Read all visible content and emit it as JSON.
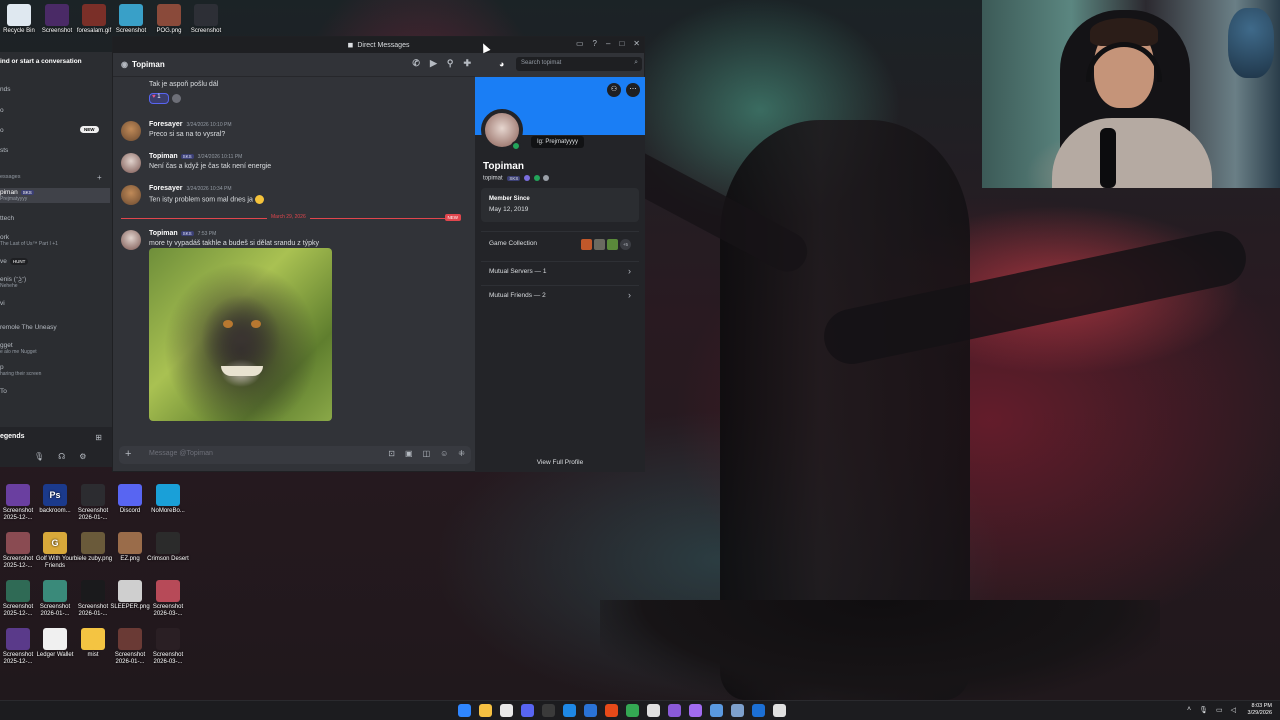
{
  "desktop": {
    "top_icons": [
      {
        "label": "Recycle Bin",
        "icon": "recycle-bin-icon",
        "color": "#dfe8f0"
      },
      {
        "label": "Screenshot",
        "icon": "screenshot-thumb",
        "color": "#4a2a66"
      },
      {
        "label": "foresalam.gif",
        "icon": "gif-thumb",
        "color": "#7a2f28"
      },
      {
        "label": "Screenshot",
        "icon": "screenshot-thumb",
        "color": "#39a0c8"
      },
      {
        "label": "POG.png",
        "icon": "image-thumb",
        "color": "#8a4a3a"
      },
      {
        "label": "Screenshot",
        "icon": "screenshot-thumb",
        "color": "#2d2f36"
      }
    ],
    "grid_icons": [
      {
        "label": "Screenshot 2025-12-...",
        "color": "#6a3fa0",
        "glyph": ""
      },
      {
        "label": "backroom...",
        "color": "#1b3a8c",
        "glyph": "Ps"
      },
      {
        "label": "Screenshot 2026-01-...",
        "color": "#2c2c30",
        "glyph": ""
      },
      {
        "label": "Discord",
        "color": "#5865f2",
        "glyph": ""
      },
      {
        "label": "NoMoreBo...",
        "color": "#1aa0d8",
        "glyph": ""
      },
      {
        "label": "Screenshot 2025-12-...",
        "color": "#8a4b52",
        "glyph": ""
      },
      {
        "label": "Golf With Your Friends",
        "color": "#d8a83a",
        "glyph": "G"
      },
      {
        "label": "biele zuby.png",
        "color": "#6a5a3a",
        "glyph": ""
      },
      {
        "label": "EZ.png",
        "color": "#9a6c4a",
        "glyph": ""
      },
      {
        "label": "Crimson Desert",
        "color": "#2b2b2b",
        "glyph": ""
      },
      {
        "label": "Screenshot 2025-12-...",
        "color": "#2f6a55",
        "glyph": ""
      },
      {
        "label": "Screenshot 2026-01-...",
        "color": "#3a8a7a",
        "glyph": ""
      },
      {
        "label": "Screenshot 2026-01-...",
        "color": "#1a1a1c",
        "glyph": ""
      },
      {
        "label": "SLEEPER.png",
        "color": "#cfcfcf",
        "glyph": ""
      },
      {
        "label": "Screenshot 2026-03-...",
        "color": "#b74a58",
        "glyph": ""
      },
      {
        "label": "Screenshot 2025-12-...",
        "color": "#5a3a8a",
        "glyph": ""
      },
      {
        "label": "Ledger Wallet",
        "color": "#f0f0f0",
        "glyph": ""
      },
      {
        "label": "mist",
        "color": "#f4c442",
        "glyph": ""
      },
      {
        "label": "Screenshot 2026-01-...",
        "color": "#6a3a35",
        "glyph": ""
      },
      {
        "label": "Screenshot 2026-03-...",
        "color": "#2a1f24",
        "glyph": ""
      }
    ]
  },
  "sidebar": {
    "search_label": "ind or start a conversation",
    "items": [
      {
        "label": "nds"
      },
      {
        "label": "o"
      },
      {
        "label": "o"
      },
      {
        "label": "sts"
      },
      {
        "label": "essages"
      }
    ],
    "new_badge": "NEW",
    "dm_list": [
      {
        "name": "piman",
        "sub": "Prejmatyyyy",
        "tag": "SKS",
        "active": true
      },
      {
        "name": "ttech",
        "sub": ""
      },
      {
        "name": "ork",
        "sub": "The Last of Us™ Part I +1"
      },
      {
        "name": "ve",
        "sub": "",
        "badge": "HUNT"
      },
      {
        "name": "enis (ᵔ͜ʖᵔ)",
        "sub": "Nehehe"
      },
      {
        "name": "vi",
        "sub": ""
      },
      {
        "name": "remole The Uneasy",
        "sub": ""
      },
      {
        "name": "gget",
        "sub": "e alo me Nugget"
      },
      {
        "name": "p",
        "sub": "haring their screen"
      },
      {
        "name": "To",
        "sub": ""
      }
    ],
    "bottom_name": "egends"
  },
  "window": {
    "title": "Direct Messages",
    "dm_name": "Topiman",
    "search_placeholder": "Search topimat",
    "composer_placeholder": "Message @Topiman"
  },
  "messages": [
    {
      "author": "",
      "time": "",
      "text": "Tak je aspoň pošlu dál",
      "reaction_count": "1",
      "continuation": true
    },
    {
      "author": "Foresayer",
      "time": "3/24/2026 10:10 PM",
      "text": "Preco si sa na to vysral?",
      "tag": ""
    },
    {
      "author": "Topiman",
      "time": "3/24/2026 10:11 PM",
      "text": "Není čas a když je čas tak není energie",
      "tag": "SKS"
    },
    {
      "author": "Foresayer",
      "time": "3/24/2026 10:34 PM",
      "text": "Ten isty problem som mal dnes ja",
      "tag": ""
    },
    {
      "author": "Topiman",
      "time": "7:53 PM",
      "text": "more ty vypadáš takhle a budeš si dělat srandu z týpky",
      "tag": "SKS"
    }
  ],
  "divider": {
    "date": "March 29, 2026",
    "new_label": "NEW"
  },
  "profile": {
    "tooltip": "Ig: Prejmatyyyy",
    "display_name": "Topiman",
    "username": "topimat",
    "tag": "SKS",
    "member_since_label": "Member Since",
    "member_since": "May 12, 2019",
    "game_collection_label": "Game Collection",
    "games_more": "+5",
    "mutual_servers": "Mutual Servers — 1",
    "mutual_friends": "Mutual Friends — 2",
    "view_full": "View Full Profile"
  },
  "taskbar": {
    "time": "8:03 PM",
    "date": "3/29/2026",
    "app_colors": [
      "#2f86ff",
      "#f6c142",
      "#e8e8e8",
      "#5865f2",
      "#3a3a3a",
      "#1e88e5",
      "#2a73d6",
      "#e64a19",
      "#34a853",
      "#e0e0e0",
      "#8a5ad8",
      "#a16bf0",
      "#5a9ae0",
      "#7da0cc",
      "#1c6fd4",
      "#e0e0e0"
    ]
  },
  "colors": {
    "accent": "#5865f2",
    "banner": "#1a7ef5",
    "online": "#23a55a",
    "new": "#e0464d"
  }
}
